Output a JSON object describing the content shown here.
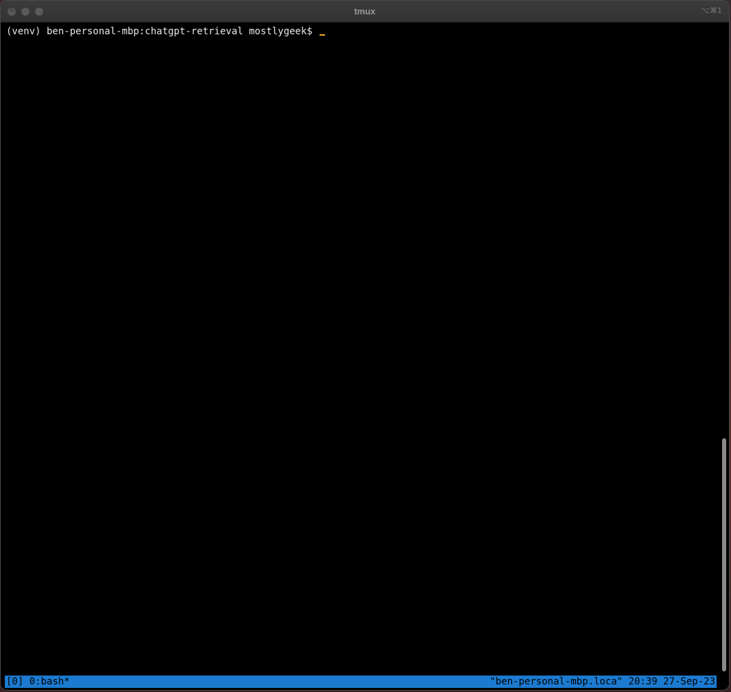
{
  "window": {
    "title": "tmux",
    "shortcut": "⌥⌘1"
  },
  "terminal": {
    "prompt": "(venv) ben-personal-mbp:chatgpt-retrieval mostlygeek$ "
  },
  "tmux_status": {
    "session": "[0]",
    "window": "0:bash*",
    "host": "\"ben-personal-mbp.loca\"",
    "time": "20:39",
    "date": "27-Sep-23"
  },
  "colors": {
    "status_bar": "#1c7bd1",
    "cursor": "#f5a623",
    "terminal_bg": "#000000",
    "terminal_fg": "#e8e8e8"
  }
}
